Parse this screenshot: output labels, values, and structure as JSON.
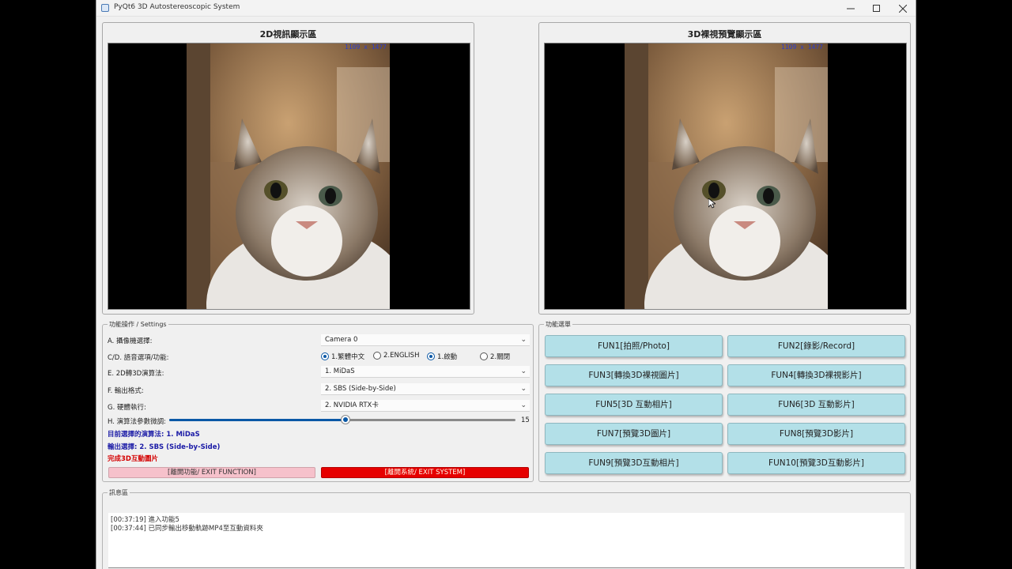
{
  "window": {
    "title": "PyQt6 3D Autostereoscopic System"
  },
  "display2d": {
    "title": "2D視訊顯示區",
    "size_label": "1109 x 1477"
  },
  "display3d": {
    "title": "3D裸視預覽顯示區",
    "size_label": "1109 x 1477"
  },
  "settings": {
    "legend": "功能操作 / Settings",
    "camera": {
      "label": "A. 攝像機選擇:",
      "value": "Camera 0"
    },
    "language": {
      "label": "C/D. 語音選項/功能:",
      "options": [
        "1.繁體中文",
        "2.ENGLISH",
        "1.啟動",
        "2.關閉"
      ],
      "selected": [
        "1.繁體中文",
        "1.啟動"
      ]
    },
    "algorithm": {
      "label": "E. 2D轉3D演算法:",
      "value": "1. MiDaS"
    },
    "output": {
      "label": "F. 輸出格式:",
      "value": "2. SBS (Side-by-Side)"
    },
    "hardware": {
      "label": "G. 硬體執行:",
      "value": "2. NVIDIA RTX卡"
    },
    "param": {
      "label": "H. 演算法參數微調:",
      "value": 15,
      "fraction": 0.51
    },
    "status_algorithm": "目前選擇的演算法: 1. MiDaS",
    "status_output": "輸出選擇: 2. SBS (Side-by-Side)",
    "status_done": "完成3D互動圖片",
    "exit_function": "[離開功能/ EXIT FUNCTION]",
    "exit_system": "[離開系統/ EXIT SYSTEM]"
  },
  "menu": {
    "legend": "功能選單",
    "buttons": [
      "FUN1[拍照/Photo]",
      "FUN2[錄影/Record]",
      "FUN3[轉換3D裸視圖片]",
      "FUN4[轉換3D裸視影片]",
      "FUN5[3D 互動相片]",
      "FUN6[3D 互動影片]",
      "FUN7[預覽3D圖片]",
      "FUN8[預覽3D影片]",
      "FUN9[預覽3D互動相片]",
      "FUN10[預覽3D互動影片]"
    ]
  },
  "log": {
    "legend": "訊息區",
    "lines": [
      "[00:37:19] 進入功能5",
      "[00:37:44] 已同步輸出移動軌跡MP4至互動資料夾"
    ]
  },
  "colors": {
    "accent": "#0a58a6",
    "status_blue": "#1a1aa6",
    "status_red": "#d40000",
    "fun_button": "#b3e0e8",
    "exit_function": "#f6c1cb",
    "exit_system": "#e60000"
  }
}
